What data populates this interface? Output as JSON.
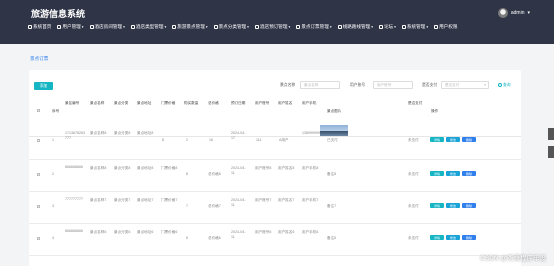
{
  "header": {
    "brand": "旅游信息系统",
    "user": "admin",
    "nav": [
      "系统首页",
      "用户管理",
      "酒店房间管理",
      "酒店类型管理",
      "旅游景点管理",
      "景点分类管理",
      "酒店预订管理",
      "景点订票管理",
      "线路路线管理",
      "论坛",
      "系统管理",
      "用户权限"
    ]
  },
  "page": {
    "title": "景点订票",
    "add_button": "添加",
    "filters": [
      {
        "label": "景点名称",
        "placeholder": "景点名称"
      },
      {
        "label": "用户账号",
        "placeholder": "用户账号"
      },
      {
        "label": "是否支付",
        "placeholder": "是否支付"
      }
    ],
    "search_button": "查询"
  },
  "table": {
    "headers": [
      "序号",
      "景区编号",
      "景点名称",
      "景点分类",
      "景点地址",
      "门票价格",
      "购买数量",
      "总价格",
      "预订日期",
      "用户账号",
      "用户姓名",
      "用户手机",
      "景点图片",
      "是否支付",
      "操作"
    ],
    "rows": [
      {
        "index": "1",
        "code": "1713678263777",
        "name": "景点名称8",
        "cat": "景点分类8",
        "addr": "景点地址8",
        "price": "8",
        "qty": "2",
        "total": "16",
        "date": "2024-04-17",
        "account": "111",
        "uname": "A用户",
        "phone": "13899999999",
        "pay": "已支付",
        "status": "未支付"
      },
      {
        "index": "2",
        "code": "666668666",
        "name": "景点名称8",
        "cat": "景点分类8",
        "addr": "景点地址8",
        "price": "门票价格8",
        "qty": "8",
        "total": "总价格8",
        "date": "2024-04-11",
        "account": "用户账号8",
        "uname": "用户姓名8",
        "phone": "用户手机8",
        "pay": "备注8",
        "status": "未支付"
      },
      {
        "index": "3",
        "code": "777777777",
        "name": "景点名称7",
        "cat": "景点分类7",
        "addr": "景点地址7",
        "price": "门票价格7",
        "qty": "7",
        "total": "总价格7",
        "date": "2024-04-11",
        "account": "用户账号7",
        "uname": "用户姓名7",
        "phone": "用户手机7",
        "pay": "备注7",
        "status": "未支付"
      },
      {
        "index": "4",
        "code": "666666666",
        "name": "景点名称6",
        "cat": "景点分类6",
        "addr": "景点地址6",
        "price": "门票价格6",
        "qty": "6",
        "total": "总价格6",
        "date": "2024-04-11",
        "account": "用户账号6",
        "uname": "用户姓名6",
        "phone": "用户手机6",
        "pay": "备注6",
        "status": "未支付"
      }
    ],
    "actions": [
      "详情",
      "修改",
      "删除"
    ]
  },
  "watermark": "CSDN @杰哥程序毕设",
  "colors": {
    "header_bg": "#2f3446",
    "accent": "#16b5c4",
    "title": "#2f80ed"
  }
}
